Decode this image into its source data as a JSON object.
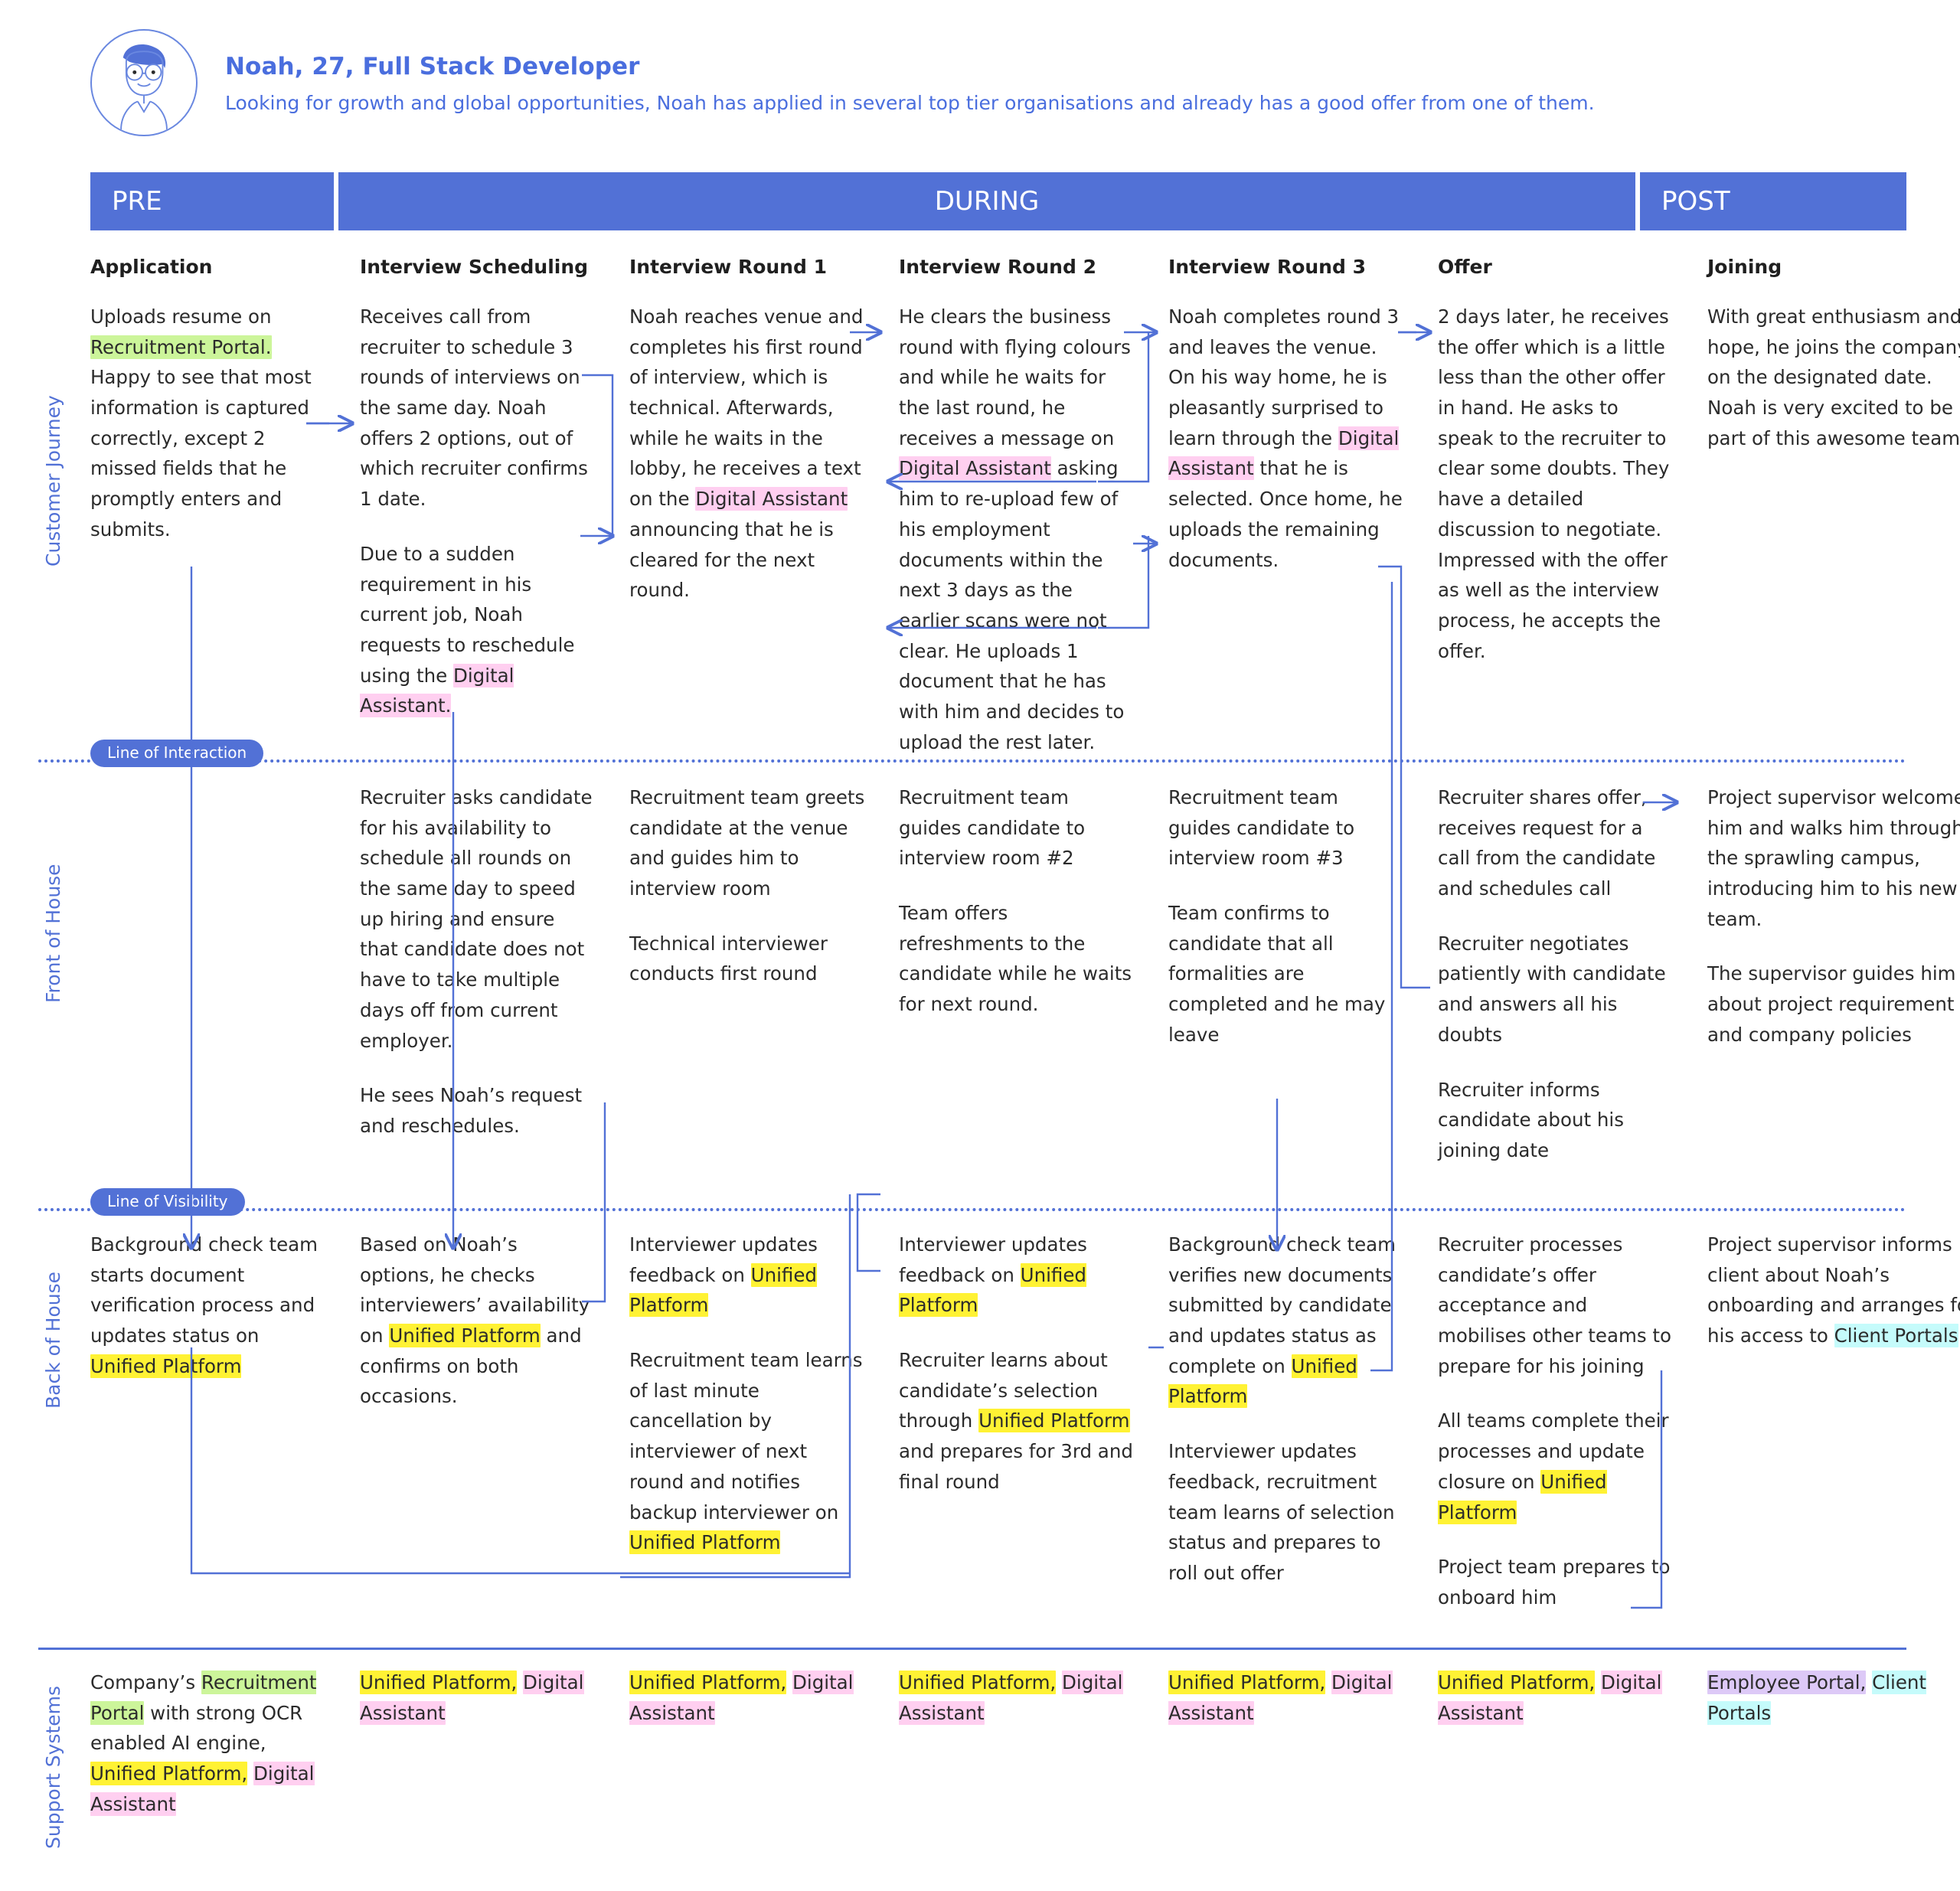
{
  "persona": {
    "name": "Noah, 27, Full Stack Developer",
    "description": "Looking for growth and global opportunities, Noah has applied in several top tier organisations and already has a good offer from one of them.",
    "avatar_icon": "persona-avatar-icon"
  },
  "colors": {
    "brand_blue": "#5271d6",
    "text_blue": "#4a6ede",
    "highlight_green": "#ccf59a",
    "highlight_pink": "#ffcff0",
    "highlight_yellow": "#fff234",
    "highlight_cyan": "#c5fbfb",
    "highlight_purple": "#ddc9f7"
  },
  "phases": [
    {
      "label": "PRE"
    },
    {
      "label": "DURING"
    },
    {
      "label": "POST"
    }
  ],
  "lanes": {
    "customer_journey": "Customer Journey",
    "front_of_house": "Front of House",
    "back_of_house": "Back of House",
    "support_systems": "Support Systems"
  },
  "lines": {
    "interaction": "Line of Interaction",
    "visibility": "Line of Visibility"
  },
  "stages": [
    "Application",
    "Interview Scheduling",
    "Interview Round 1",
    "Interview Round 2",
    "Interview Round 3",
    "Offer",
    "Joining"
  ],
  "customer_journey": [
    {
      "paragraphs": [
        [
          {
            "t": "Uploads resume on "
          },
          {
            "t": "Recruitment Portal.",
            "h": "green"
          },
          {
            "t": " Happy to see that most information is captured correctly, except 2 missed fields that he promptly enters and submits."
          }
        ]
      ]
    },
    {
      "paragraphs": [
        [
          {
            "t": "Receives call from recruiter to schedule 3 rounds of interviews on the same day. Noah offers 2 options, out of which recruiter confirms 1 date."
          }
        ],
        [
          {
            "t": "Due to a sudden requirement in his current job, Noah requests to reschedule using the "
          },
          {
            "t": "Digital Assistant.",
            "h": "pink"
          }
        ]
      ]
    },
    {
      "paragraphs": [
        [
          {
            "t": "Noah reaches venue and completes his first round of interview, which is technical. Afterwards, while he waits in the lobby, he receives a text on the "
          },
          {
            "t": "Digital Assistant",
            "h": "pink"
          },
          {
            "t": " announcing that he is cleared for the next round."
          }
        ]
      ]
    },
    {
      "paragraphs": [
        [
          {
            "t": "He clears the business round with flying colours and while he waits for the last round, he receives a message on "
          },
          {
            "t": "Digital Assistant",
            "h": "pink"
          },
          {
            "t": " asking him to re-upload few of his employment documents within the next 3 days as the earlier scans were not clear. He uploads 1 document that he has with him and decides to upload the rest later."
          }
        ]
      ]
    },
    {
      "paragraphs": [
        [
          {
            "t": "Noah completes round 3 and leaves the venue. On his way home, he is pleasantly surprised to learn through the "
          },
          {
            "t": "Digital Assistant",
            "h": "pink"
          },
          {
            "t": " that he is selected. Once home, he uploads the remaining documents."
          }
        ]
      ]
    },
    {
      "paragraphs": [
        [
          {
            "t": "2 days later, he receives the offer which is a little less than the other offer in hand. He asks to speak to the recruiter to clear some doubts. They have a detailed discussion to negotiate. Impressed with the offer as well as the interview process, he accepts the offer."
          }
        ]
      ]
    },
    {
      "paragraphs": [
        [
          {
            "t": "With great enthusiasm and hope, he joins the company on the designated date. Noah is very excited to be a part of this awesome team."
          }
        ]
      ]
    }
  ],
  "front_of_house": [
    {
      "paragraphs": []
    },
    {
      "paragraphs": [
        [
          {
            "t": "Recruiter asks candidate for his availability to schedule all rounds on the same day to speed up hiring and ensure that candidate does not have to take multiple days off from current employer."
          }
        ],
        [
          {
            "t": "He sees Noah’s request and reschedules."
          }
        ]
      ]
    },
    {
      "paragraphs": [
        [
          {
            "t": "Recruitment team greets candidate at the venue and guides him to interview room"
          }
        ],
        [
          {
            "t": "Technical interviewer conducts first round"
          }
        ]
      ]
    },
    {
      "paragraphs": [
        [
          {
            "t": "Recruitment team guides candidate to interview room #2"
          }
        ],
        [
          {
            "t": "Team offers refreshments to the candidate while he waits for next round."
          }
        ]
      ]
    },
    {
      "paragraphs": [
        [
          {
            "t": "Recruitment team guides candidate to interview room #3"
          }
        ],
        [
          {
            "t": "Team confirms to candidate that all formalities are completed and he may leave"
          }
        ]
      ]
    },
    {
      "paragraphs": [
        [
          {
            "t": "Recruiter shares offer, receives request for a call from the candidate and schedules call"
          }
        ],
        [
          {
            "t": "Recruiter negotiates patiently with candidate and answers all his doubts"
          }
        ],
        [
          {
            "t": "Recruiter informs candidate about his joining date"
          }
        ]
      ]
    },
    {
      "paragraphs": [
        [
          {
            "t": "Project supervisor welcomes him and walks him through the sprawling campus, introducing him to his new team."
          }
        ],
        [
          {
            "t": "The supervisor guides him about project requirement and company policies"
          }
        ]
      ]
    }
  ],
  "back_of_house": [
    {
      "paragraphs": [
        [
          {
            "t": "Background check team starts document verification process and updates status on "
          },
          {
            "t": "Unified Platform",
            "h": "yellow"
          }
        ]
      ]
    },
    {
      "paragraphs": [
        [
          {
            "t": "Based on Noah’s options, he checks interviewers’ availability on "
          },
          {
            "t": "Unified Platform",
            "h": "yellow"
          },
          {
            "t": " and confirms on both occasions."
          }
        ]
      ]
    },
    {
      "paragraphs": [
        [
          {
            "t": "Interviewer updates feedback on "
          },
          {
            "t": "Unified Platform",
            "h": "yellow"
          }
        ],
        [
          {
            "t": "Recruitment team learns of last minute cancellation by interviewer of next round and notifies backup interviewer on "
          },
          {
            "t": "Unified Platform",
            "h": "yellow"
          }
        ]
      ]
    },
    {
      "paragraphs": [
        [
          {
            "t": "Interviewer updates feedback on "
          },
          {
            "t": "Unified Platform",
            "h": "yellow"
          }
        ],
        [
          {
            "t": "Recruiter learns about candidate’s selection through "
          },
          {
            "t": "Unified Platform",
            "h": "yellow"
          },
          {
            "t": " and prepares for 3rd and final round"
          }
        ]
      ]
    },
    {
      "paragraphs": [
        [
          {
            "t": "Background check team verifies new documents submitted by candidate and updates status as complete on "
          },
          {
            "t": "Unified Platform",
            "h": "yellow"
          }
        ],
        [
          {
            "t": "Interviewer updates feedback, recruitment team learns of selection status and prepares to roll out offer"
          }
        ]
      ]
    },
    {
      "paragraphs": [
        [
          {
            "t": "Recruiter processes candidate’s offer acceptance and mobilises other teams to prepare for his joining"
          }
        ],
        [
          {
            "t": "All teams complete their processes and update closure on "
          },
          {
            "t": "Unified Platform",
            "h": "yellow"
          }
        ],
        [
          {
            "t": "Project team prepares to onboard him"
          }
        ]
      ]
    },
    {
      "paragraphs": [
        [
          {
            "t": "Project supervisor informs client about Noah’s onboarding and arranges for his access to "
          },
          {
            "t": "Client Portals",
            "h": "cyan"
          }
        ]
      ]
    }
  ],
  "support_systems": [
    {
      "paragraphs": [
        [
          {
            "t": "Company’s "
          },
          {
            "t": "Recruitment Portal",
            "h": "green"
          },
          {
            "t": " with strong OCR enabled AI engine, "
          },
          {
            "t": "Unified Platform,",
            "h": "yellow"
          },
          {
            "t": " "
          },
          {
            "t": "Digital Assistant",
            "h": "pink"
          }
        ]
      ]
    },
    {
      "paragraphs": [
        [
          {
            "t": "Unified Platform,",
            "h": "yellow"
          },
          {
            "t": " "
          },
          {
            "t": "Digital Assistant",
            "h": "pink"
          }
        ]
      ]
    },
    {
      "paragraphs": [
        [
          {
            "t": "Unified Platform,",
            "h": "yellow"
          },
          {
            "t": " "
          },
          {
            "t": "Digital Assistant",
            "h": "pink"
          }
        ]
      ]
    },
    {
      "paragraphs": [
        [
          {
            "t": "Unified Platform,",
            "h": "yellow"
          },
          {
            "t": " "
          },
          {
            "t": "Digital Assistant",
            "h": "pink"
          }
        ]
      ]
    },
    {
      "paragraphs": [
        [
          {
            "t": "Unified Platform,",
            "h": "yellow"
          },
          {
            "t": " "
          },
          {
            "t": "Digital Assistant",
            "h": "pink"
          }
        ]
      ]
    },
    {
      "paragraphs": [
        [
          {
            "t": "Unified Platform,",
            "h": "yellow"
          },
          {
            "t": " "
          },
          {
            "t": "Digital Assistant",
            "h": "pink"
          }
        ]
      ]
    },
    {
      "paragraphs": [
        [
          {
            "t": "Employee Portal,",
            "h": "purple"
          },
          {
            "t": " "
          },
          {
            "t": "Client Portals",
            "h": "cyan"
          }
        ]
      ]
    }
  ]
}
